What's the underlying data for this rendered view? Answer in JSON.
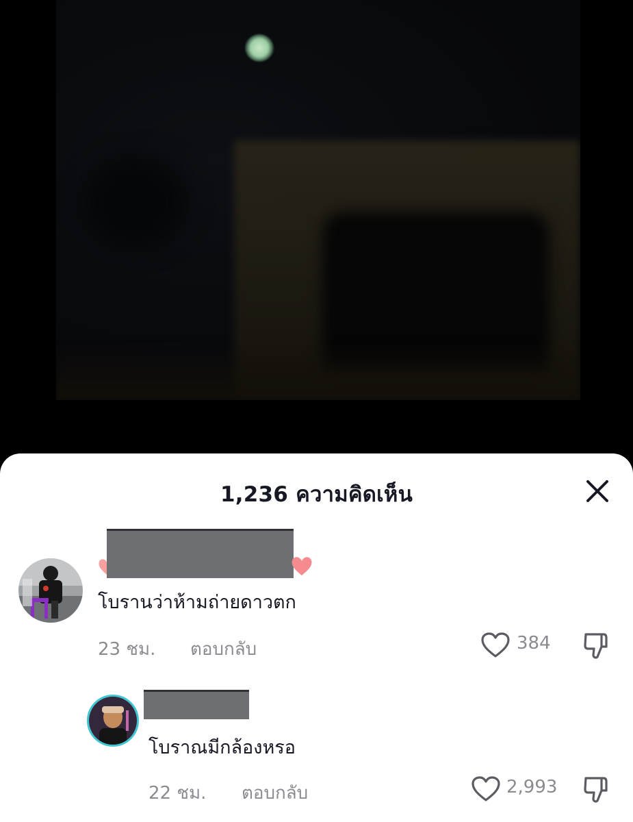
{
  "video": {
    "description_icon": "video-frame"
  },
  "comments_sheet": {
    "count": "1,236",
    "count_label": "ความคิดเห็น",
    "close_icon": "close-icon"
  },
  "comments": [
    {
      "text": "โบรานว่าห้ามถ่ายดาวตก",
      "time": "23 ชม.",
      "reply_label": "ตอบกลับ",
      "likes": "384"
    },
    {
      "text": "โบราณมีกล้องหรอ",
      "time": "22 ชม.",
      "reply_label": "ตอบกลับ",
      "likes": "2,993"
    }
  ],
  "colors": {
    "text_primary": "#161823",
    "text_secondary": "#8a8b91",
    "heart_pink": "#f58b8e",
    "story_ring": "#3ec7d3"
  }
}
